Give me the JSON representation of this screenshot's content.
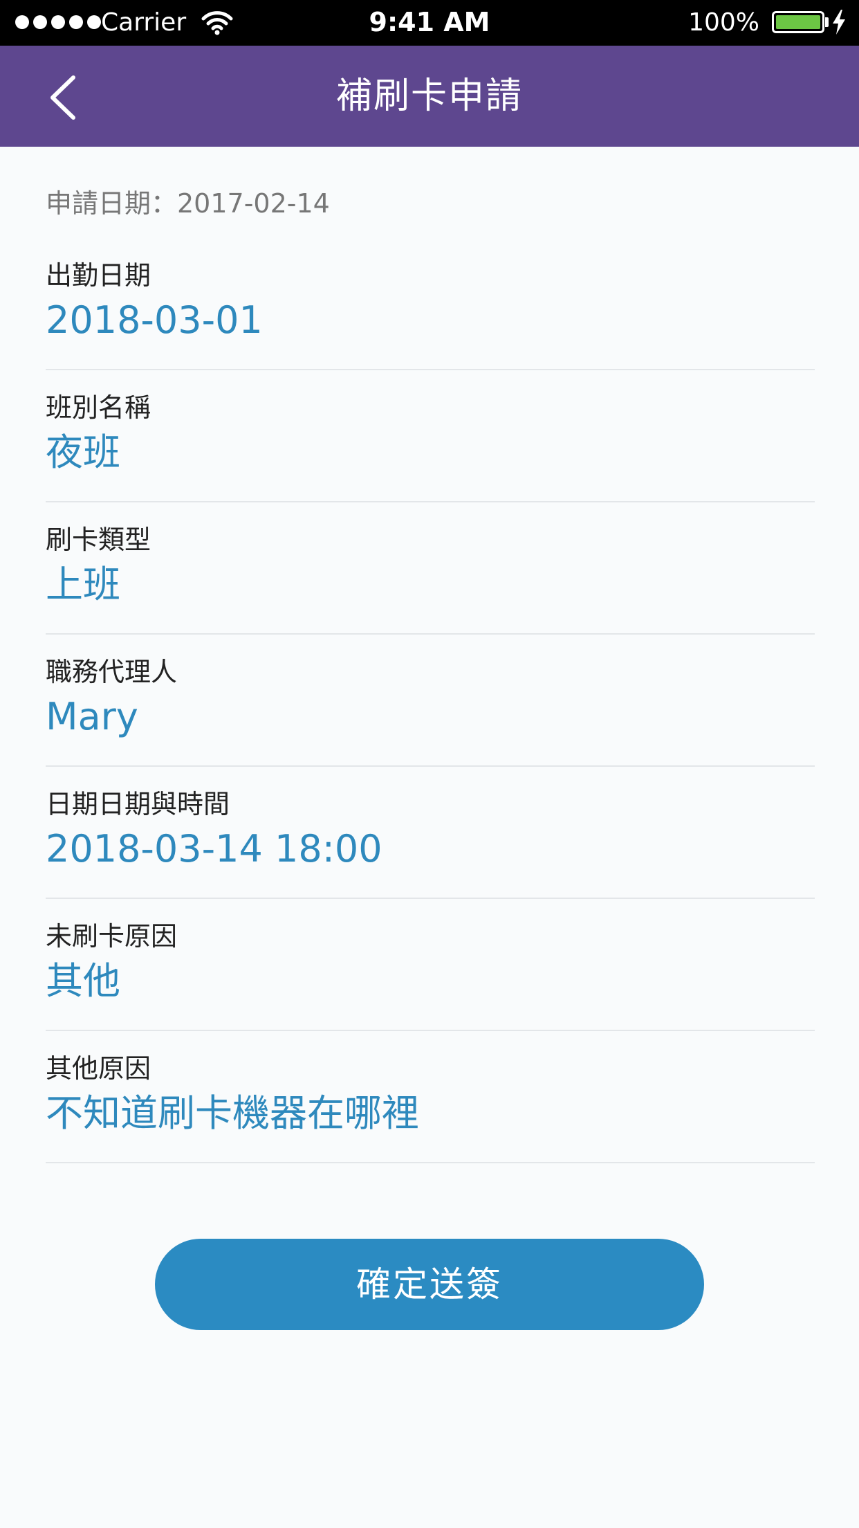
{
  "status_bar": {
    "carrier": "Carrier",
    "time": "9:41 AM",
    "battery": "100%",
    "battery_color": "#6cc644",
    "signal_icon": "signal-dots-icon",
    "wifi_icon": "wifi-icon",
    "charging_icon": "bolt-icon"
  },
  "nav": {
    "title": "補刷卡申請",
    "back_icon": "chevron-left-icon",
    "background": "#5e478f"
  },
  "form": {
    "apply_date": "申請日期：2017-02-14",
    "fields": [
      {
        "label": "出勤日期",
        "value": "2018-03-01"
      },
      {
        "label": "班別名稱",
        "value": "夜班"
      },
      {
        "label": "刷卡類型",
        "value": "上班"
      },
      {
        "label": "職務代理人",
        "value": "Mary"
      },
      {
        "label": "日期日期與時間",
        "value": "2018-03-14 18:00"
      },
      {
        "label": "未刷卡原因",
        "value": "其他"
      },
      {
        "label": "其他原因",
        "value": "不知道刷卡機器在哪裡"
      }
    ],
    "value_color": "#2e89bd"
  },
  "submit": {
    "label": "確定送簽",
    "color": "#2b8bc2"
  }
}
